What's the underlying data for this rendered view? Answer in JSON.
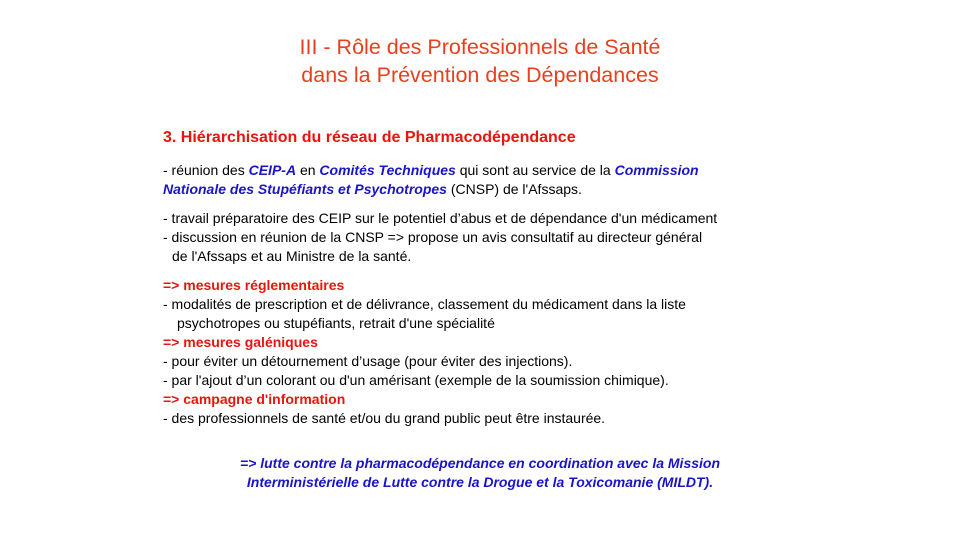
{
  "slide": {
    "title_line1": "III - Rôle des Professionnels de Santé",
    "title_line2": "dans la Prévention des Dépendances",
    "subtitle": "3. Hiérarchisation du réseau de Pharmacodépendance",
    "p1": {
      "a": "- réunion des ",
      "b": "CEIP-A",
      "c": " en ",
      "d": "Comités Techniques",
      "e": " qui sont au service de la ",
      "f": "Commission",
      "g": "Nationale des Stupéfiants et Psychotropes",
      "h": " (CNSP) de l'Afssaps."
    },
    "p2_line1": "- travail préparatoire des CEIP sur le potentiel d’abus et de dépendance d'un médicament",
    "p2_line2": "- discussion en réunion de la CNSP => propose un avis consultatif au directeur général",
    "p2_line3": "de l'Afssaps et au Ministre de la santé.",
    "m1_heading": "=> mesures réglementaires",
    "m1_line1": "- modalités de prescription et de délivrance, classement du médicament dans la liste",
    "m1_line2": "psychotropes ou stupéfiants, retrait d'une spécialité",
    "m2_heading": "=> mesures galéniques",
    "m2_line1": "- pour éviter un détournement d’usage (pour éviter des injections).",
    "m2_line2": "- par l'ajout d’un colorant ou d'un amérisant (exemple de la soumission chimique).",
    "m3_heading": "=> campagne d'information",
    "m3_line1": "- des professionnels de santé et/ou du grand public peut être instaurée.",
    "conclusion_line1": "=> lutte contre la pharmacodépendance en coordination avec la Mission",
    "conclusion_line2": "Interministérielle de Lutte contre la Drogue et la Toxicomanie (MILDT)."
  },
  "colors": {
    "title": "#e8401c",
    "accent_red": "#e8150d",
    "accent_blue": "#1a14c8",
    "text": "#000000",
    "background": "#ffffff"
  }
}
